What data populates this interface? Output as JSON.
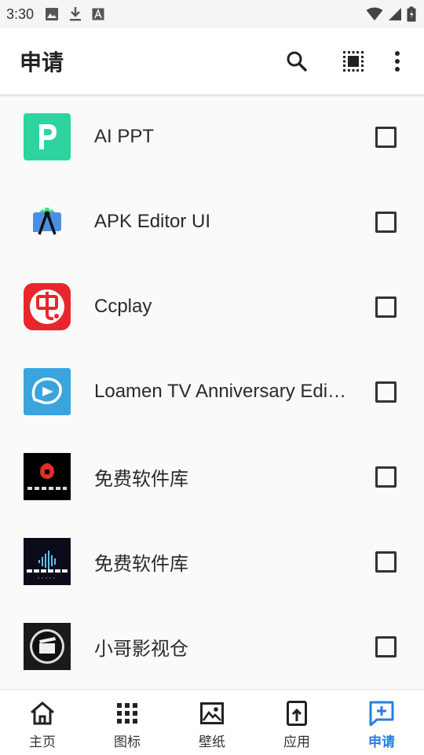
{
  "status_bar": {
    "time": "3:30"
  },
  "app_bar": {
    "title": "申请",
    "actions": [
      "search-icon",
      "select-all-icon",
      "more-vert-icon"
    ]
  },
  "apps": [
    {
      "name": "AI PPT",
      "icon": "ai-ppt-icon",
      "checked": false
    },
    {
      "name": "APK Editor UI",
      "icon": "apk-editor-icon",
      "checked": false
    },
    {
      "name": "Ccplay",
      "icon": "ccplay-icon",
      "checked": false
    },
    {
      "name": "Loamen TV Anniversary Edition",
      "icon": "loamen-tv-icon",
      "checked": false
    },
    {
      "name": "免费软件库",
      "icon": "free-software-library-icon",
      "checked": false
    },
    {
      "name": "免费软件库",
      "icon": "free-software-library-icon",
      "checked": false
    },
    {
      "name": "小哥影视仓",
      "icon": "xiaoge-video-icon",
      "checked": false
    }
  ],
  "bottom_nav": {
    "items": [
      {
        "label": "主页",
        "icon": "home-icon",
        "active": false
      },
      {
        "label": "图标",
        "icon": "grid-icon",
        "active": false
      },
      {
        "label": "壁纸",
        "icon": "image-icon",
        "active": false
      },
      {
        "label": "应用",
        "icon": "upload-app-icon",
        "active": false
      },
      {
        "label": "申请",
        "icon": "request-add-icon",
        "active": true
      }
    ]
  },
  "colors": {
    "accent": "#2a7de1",
    "background": "#fafafa",
    "app_bar": "#ffffff"
  }
}
